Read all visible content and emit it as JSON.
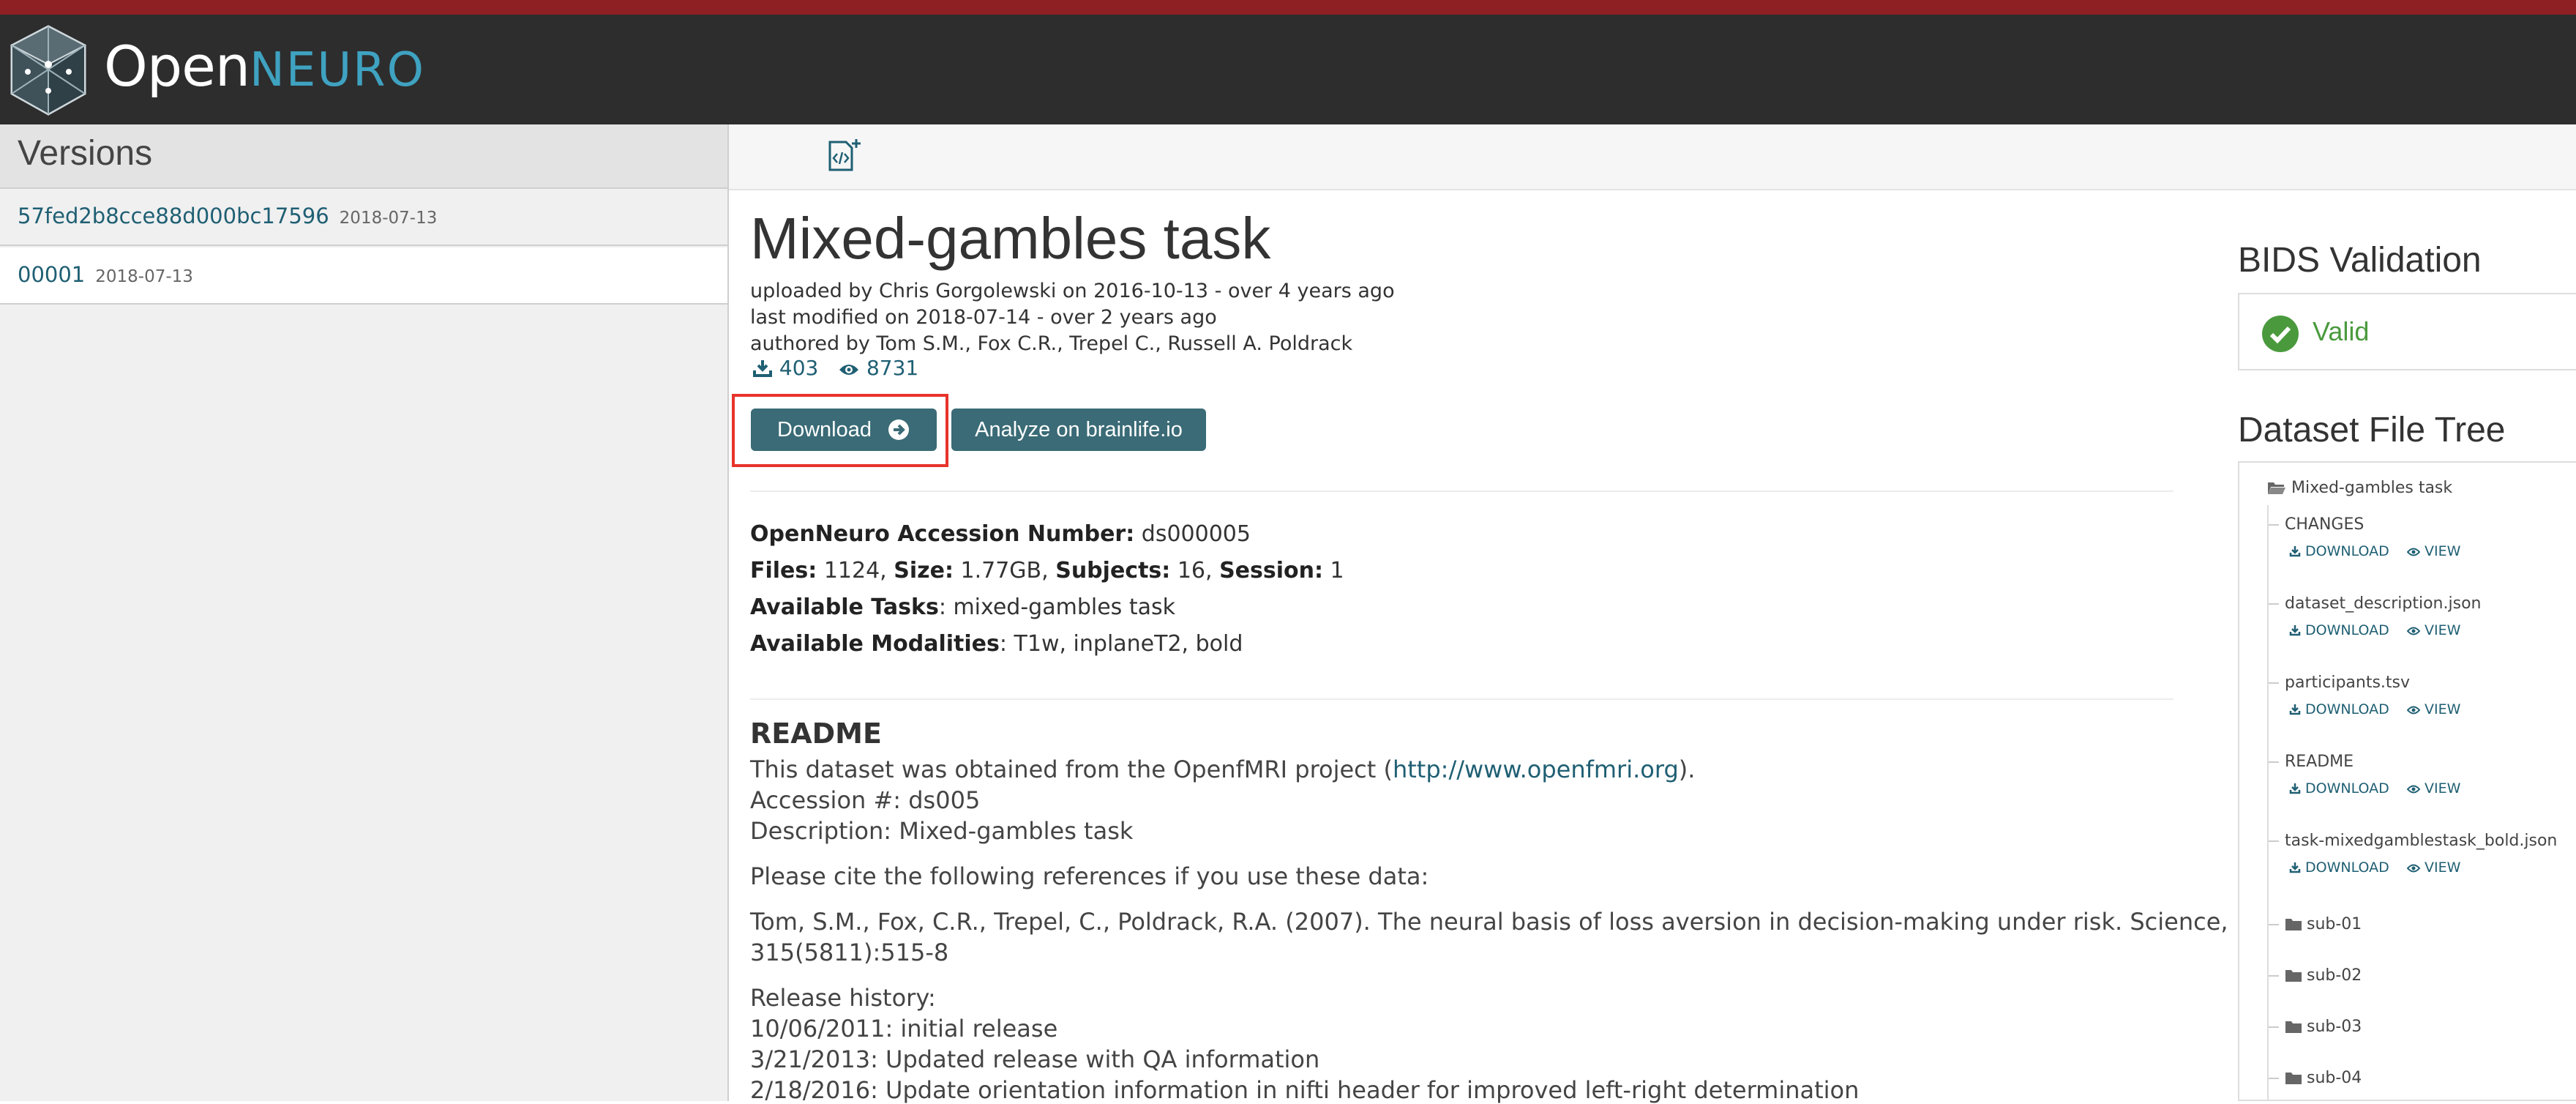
{
  "header": {
    "brand_open": "Open",
    "brand_neuro": "NEURO",
    "brand_color": "#3fa2c1",
    "stripe_color": "#8e2023"
  },
  "sidebar": {
    "title": "Versions",
    "versions": [
      {
        "id": "57fed2b8cce88d000bc17596",
        "date": "2018-07-13"
      },
      {
        "id": "00001",
        "date": "2018-07-13"
      }
    ]
  },
  "dataset": {
    "title": "Mixed-gambles task",
    "uploaded": "uploaded by Chris Gorgolewski on 2016-10-13 - over 4 years ago",
    "modified": "last modified on 2018-07-14 - over 2 years ago",
    "authored": "authored by Tom S.M., Fox C.R., Trepel C., Russell A. Poldrack",
    "downloads": "403",
    "views": "8731",
    "download_label": "Download",
    "analyze_label": "Analyze on brainlife.io",
    "accession_label": "OpenNeuro Accession Number:",
    "accession": "ds000005",
    "files_label": "Files:",
    "files": "1124,",
    "size_label": "Size:",
    "size": "1.77GB,",
    "subjects_label": "Subjects:",
    "subjects": "16,",
    "session_label": "Session:",
    "session": "1",
    "tasks_label": "Available Tasks",
    "tasks": ": mixed-gambles task",
    "modalities_label": "Available Modalities",
    "modalities": ": T1w, inplaneT2, bold"
  },
  "readme": {
    "heading": "README",
    "line1_pre": "This dataset was obtained from the OpenfMRI project (",
    "line1_link": "http://www.openfmri.org",
    "line1_post": ").",
    "line2": "Accession #: ds005",
    "line3": "Description: Mixed-gambles task",
    "line4": "Please cite the following references if you use these data:",
    "line5": "Tom, S.M., Fox, C.R., Trepel, C., Poldrack, R.A. (2007). The neural basis of loss aversion in decision-making under risk. Science,",
    "line6": "315(5811):515-8",
    "line7": "Release history:",
    "line8": "10/06/2011: initial release",
    "line9": "3/21/2013: Updated release with QA information",
    "line10": "2/18/2016: Update orientation information in nifti header for improved left-right determination"
  },
  "validation": {
    "heading": "BIDS Validation",
    "status": "Valid",
    "status_color": "#4a9a3d"
  },
  "file_tree": {
    "heading": "Dataset File Tree",
    "root": "Mixed-gambles task",
    "download_label": "DOWNLOAD",
    "view_label": "VIEW",
    "files": [
      "CHANGES",
      "dataset_description.json",
      "participants.tsv",
      "README",
      "task-mixedgamblestask_bold.json"
    ],
    "folders": [
      "sub-01",
      "sub-02",
      "sub-03",
      "sub-04"
    ]
  }
}
